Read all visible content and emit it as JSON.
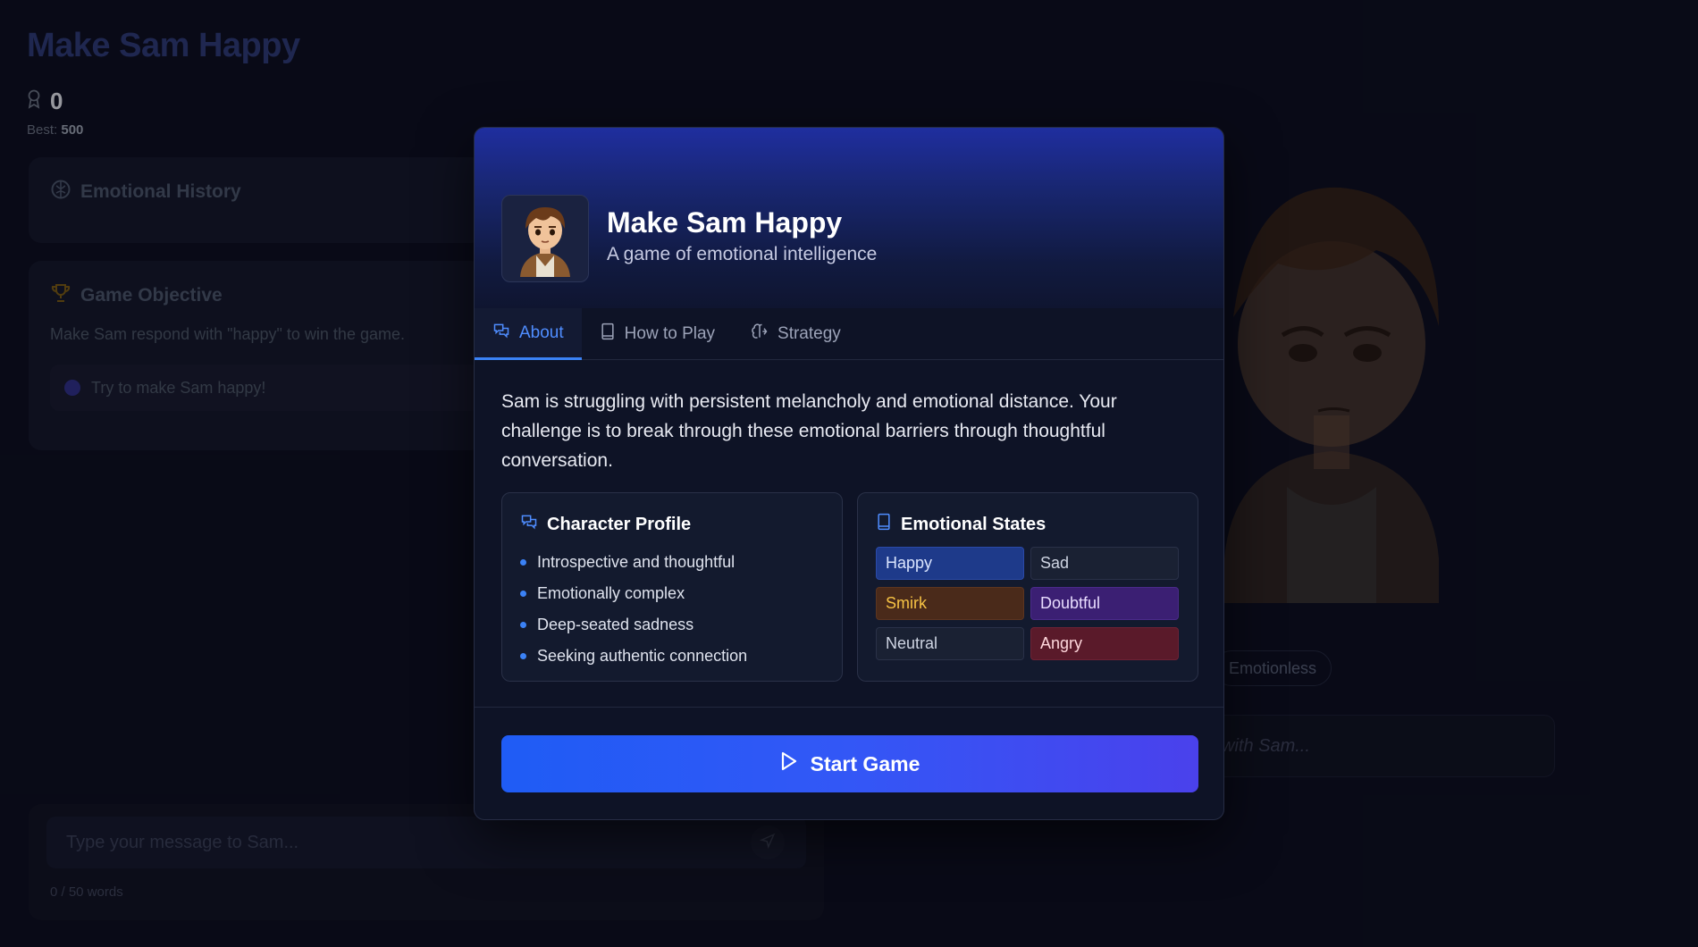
{
  "app": {
    "title": "Make Sam Happy",
    "score": "0",
    "best_label": "Best:",
    "best_value": "500"
  },
  "emotional_history": {
    "title": "Emotional History"
  },
  "objective": {
    "title": "Game Objective",
    "text": "Make Sam respond with \"happy\" to win the game.",
    "hint": "Try to make Sam happy!"
  },
  "chat": {
    "placeholder": "Type your message to Sam...",
    "word_count": "0 / 50 words",
    "right_placeholder": "with Sam...",
    "current_emotion": "Emotionless"
  },
  "modal": {
    "title": "Make Sam Happy",
    "subtitle": "A game of emotional intelligence",
    "tabs": [
      {
        "label": "About",
        "icon": "chat-bubbles-icon",
        "active": true
      },
      {
        "label": "How to Play",
        "icon": "book-icon",
        "active": false
      },
      {
        "label": "Strategy",
        "icon": "brain-icon",
        "active": false
      }
    ],
    "description": "Sam is struggling with persistent melancholy and emotional distance. Your challenge is to break through these emotional barriers through thoughtful conversation.",
    "character_profile": {
      "title": "Character Profile",
      "traits": [
        "Introspective and thoughtful",
        "Emotionally complex",
        "Deep-seated sadness",
        "Seeking authentic connection"
      ]
    },
    "emotional_states": {
      "title": "Emotional States",
      "states": [
        {
          "label": "Happy",
          "bg": "#1e3a8a",
          "fg": "#dbe6ff",
          "border": "#2b4aa8"
        },
        {
          "label": "Sad",
          "bg": "#1a2133",
          "fg": "#cfd5e3",
          "border": "#2a3148"
        },
        {
          "label": "Smirk",
          "bg": "#4a2a1a",
          "fg": "#f6c244",
          "border": "#5c3520"
        },
        {
          "label": "Doubtful",
          "bg": "#3b1f73",
          "fg": "#e9ddff",
          "border": "#4a2a8a"
        },
        {
          "label": "Neutral",
          "bg": "#1a2133",
          "fg": "#cfd5e3",
          "border": "#2a3148"
        },
        {
          "label": "Angry",
          "bg": "#5a1a2a",
          "fg": "#ffd7dc",
          "border": "#6d2235"
        }
      ]
    },
    "start_button": "Start Game"
  },
  "colors": {
    "accent": "#3b82f6",
    "button_start": "#1f5cf5",
    "button_end": "#4a41ec"
  }
}
